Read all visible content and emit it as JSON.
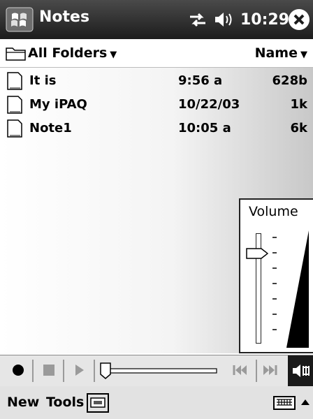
{
  "title_bar": {
    "app_title": "Notes",
    "time": "10:29"
  },
  "folder_bar": {
    "folder": "All Folders",
    "sort": "Name"
  },
  "notes": [
    {
      "name": "It is",
      "time": "9:56 a",
      "size": "628b"
    },
    {
      "name": "My iPAQ",
      "time": "10/22/03",
      "size": "1k"
    },
    {
      "name": "Note1",
      "time": "10:05 a",
      "size": "6k"
    }
  ],
  "volume": {
    "title": "Volume",
    "level": 0.85
  },
  "menu": {
    "new": "New",
    "tools": "Tools"
  },
  "icons": [
    "start-icon",
    "connectivity-icon",
    "speaker-icon",
    "close-icon",
    "folder-icon",
    "dropdown-arrow-icon",
    "note-icon",
    "record-icon",
    "stop-icon",
    "play-icon",
    "rewind-icon",
    "fast-forward-icon",
    "speaker-toggle-icon",
    "recording-toolbar-icon",
    "keyboard-icon",
    "up-arrow-icon"
  ],
  "colors": {
    "title_bar": "#2a2a2a",
    "toolbar": "#e6e6e6",
    "menu_bar": "#e2e2e2"
  }
}
